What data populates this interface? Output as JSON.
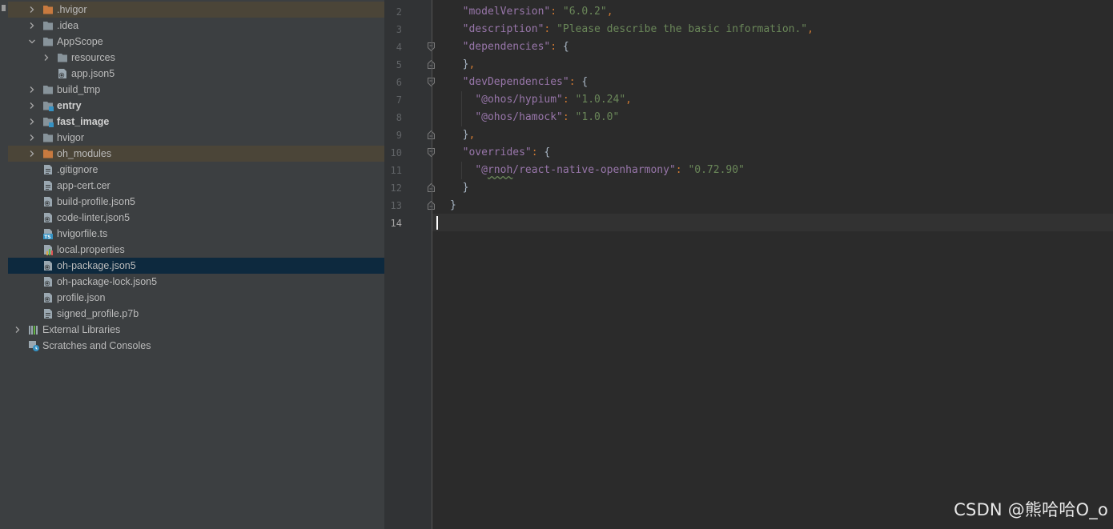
{
  "project_tree": {
    "items": [
      {
        "label": ".hvigor",
        "type": "folder",
        "color": "#c87a3f",
        "expanded": false,
        "bold": false
      },
      {
        "label": ".idea",
        "type": "folder",
        "color": "#87939a",
        "expanded": false,
        "bold": false
      },
      {
        "label": "AppScope",
        "type": "folder",
        "color": "#87939a",
        "expanded": true,
        "bold": false
      },
      {
        "label": "resources",
        "type": "folder",
        "color": "#87939a",
        "expanded": false,
        "bold": false
      },
      {
        "label": "app.json5",
        "type": "json5-file",
        "bold": false
      },
      {
        "label": "build_tmp",
        "type": "folder",
        "color": "#87939a",
        "expanded": false,
        "bold": false
      },
      {
        "label": "entry",
        "type": "module-folder",
        "color": "#87939a",
        "expanded": false,
        "bold": true
      },
      {
        "label": "fast_image",
        "type": "module-folder",
        "color": "#87939a",
        "expanded": false,
        "bold": true
      },
      {
        "label": "hvigor",
        "type": "folder",
        "color": "#87939a",
        "expanded": false,
        "bold": false
      },
      {
        "label": "oh_modules",
        "type": "folder",
        "color": "#c87a3f",
        "expanded": false,
        "bold": false
      },
      {
        "label": ".gitignore",
        "type": "text-file",
        "bold": false
      },
      {
        "label": "app-cert.cer",
        "type": "text-file",
        "bold": false
      },
      {
        "label": "build-profile.json5",
        "type": "json5-file",
        "bold": false
      },
      {
        "label": "code-linter.json5",
        "type": "json5-file",
        "bold": false
      },
      {
        "label": "hvigorfile.ts",
        "type": "ts-file",
        "bold": false
      },
      {
        "label": "local.properties",
        "type": "properties-file",
        "bold": false
      },
      {
        "label": "oh-package.json5",
        "type": "json5-file",
        "bold": false,
        "selected": true
      },
      {
        "label": "oh-package-lock.json5",
        "type": "json5-file",
        "bold": false
      },
      {
        "label": "profile.json",
        "type": "json5-file",
        "bold": false
      },
      {
        "label": "signed_profile.p7b",
        "type": "text-file",
        "bold": false
      },
      {
        "label": "External Libraries",
        "type": "libraries",
        "expanded": false,
        "bold": false
      },
      {
        "label": "Scratches and Consoles",
        "type": "scratches",
        "bold": false
      }
    ]
  },
  "editor": {
    "current_line": 14,
    "lines": [
      {
        "num": "2",
        "tokens": [
          [
            "w",
            "  "
          ],
          [
            "k",
            "\"modelVersion\""
          ],
          [
            "p",
            ": "
          ],
          [
            "s",
            "\"6.0.2\""
          ],
          [
            "p",
            ","
          ]
        ]
      },
      {
        "num": "3",
        "tokens": [
          [
            "w",
            "  "
          ],
          [
            "k",
            "\"description\""
          ],
          [
            "p",
            ": "
          ],
          [
            "s",
            "\"Please describe the basic information.\""
          ],
          [
            "p",
            ","
          ]
        ]
      },
      {
        "num": "4",
        "tokens": [
          [
            "w",
            "  "
          ],
          [
            "k",
            "\"dependencies\""
          ],
          [
            "p",
            ": "
          ],
          [
            "w",
            "{"
          ]
        ],
        "fold": "open"
      },
      {
        "num": "5",
        "tokens": [
          [
            "w",
            "  }"
          ],
          [
            "p",
            ","
          ]
        ],
        "fold": "close"
      },
      {
        "num": "6",
        "tokens": [
          [
            "w",
            "  "
          ],
          [
            "k",
            "\"devDependencies\""
          ],
          [
            "p",
            ": "
          ],
          [
            "w",
            "{"
          ]
        ],
        "fold": "open"
      },
      {
        "num": "7",
        "tokens": [
          [
            "w",
            "    "
          ],
          [
            "k",
            "\"@ohos/hypium\""
          ],
          [
            "p",
            ": "
          ],
          [
            "s",
            "\"1.0.24\""
          ],
          [
            "p",
            ","
          ]
        ]
      },
      {
        "num": "8",
        "tokens": [
          [
            "w",
            "    "
          ],
          [
            "k",
            "\"@ohos/hamock\""
          ],
          [
            "p",
            ": "
          ],
          [
            "s",
            "\"1.0.0\""
          ]
        ]
      },
      {
        "num": "9",
        "tokens": [
          [
            "w",
            "  }"
          ],
          [
            "p",
            ","
          ]
        ],
        "fold": "close"
      },
      {
        "num": "10",
        "tokens": [
          [
            "w",
            "  "
          ],
          [
            "k",
            "\"overrides\""
          ],
          [
            "p",
            ": "
          ],
          [
            "w",
            "{"
          ]
        ],
        "fold": "open"
      },
      {
        "num": "11",
        "tokens": [
          [
            "w",
            "    "
          ],
          [
            "k",
            "\"@"
          ],
          [
            "k~",
            "rnoh"
          ],
          [
            "k",
            "/react-native-openharmony\""
          ],
          [
            "p",
            ": "
          ],
          [
            "s",
            "\"0.72.90\""
          ]
        ]
      },
      {
        "num": "12",
        "tokens": [
          [
            "w",
            "  }"
          ]
        ],
        "fold": "close"
      },
      {
        "num": "13",
        "tokens": [
          [
            "w",
            "}"
          ]
        ],
        "fold": "close"
      },
      {
        "num": "14",
        "tokens": []
      }
    ]
  },
  "watermark": "CSDN @熊哈哈O_o",
  "colors": {
    "tree_bg": "#3c3f41",
    "editor_bg": "#2b2b2b",
    "selection": "#0d293e",
    "excluded_highlight": "#4b4538",
    "key": "#9876aa",
    "string": "#6a8759",
    "punct": "#cc7832"
  }
}
